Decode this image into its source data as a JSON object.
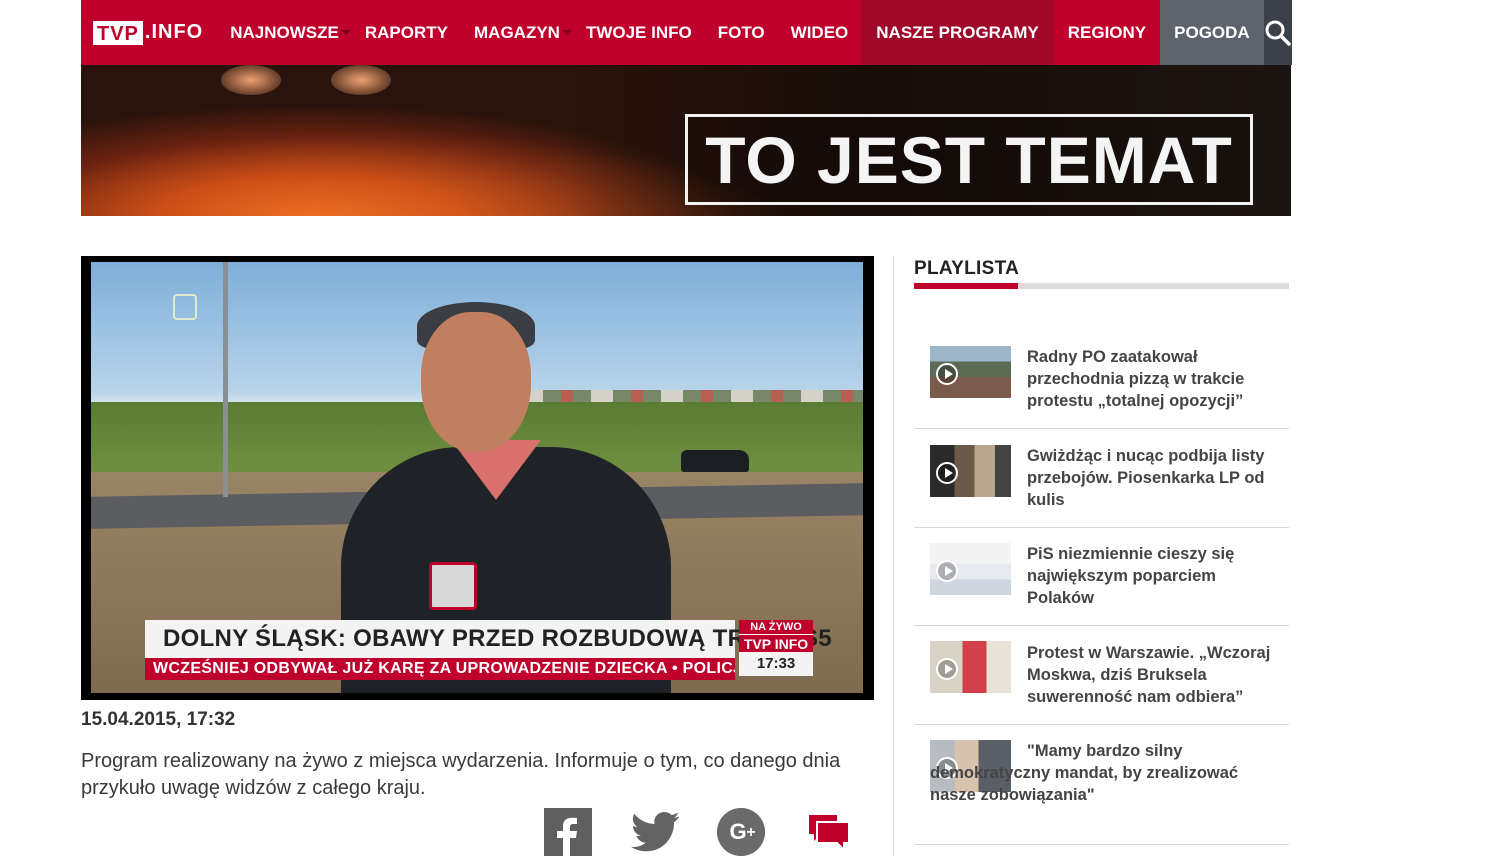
{
  "nav": {
    "logo_box": "TVP",
    "logo_rest": ".INFO",
    "items": [
      {
        "label": "NAJNOWSZE"
      },
      {
        "label": "RAPORTY"
      },
      {
        "label": "MAGAZYN"
      },
      {
        "label": "TWOJE INFO"
      },
      {
        "label": "FOTO"
      },
      {
        "label": "WIDEO"
      },
      {
        "label": "NASZE PROGRAMY"
      },
      {
        "label": "REGIONY"
      },
      {
        "label": "POGODA"
      }
    ],
    "search_icon": "search-icon",
    "colors": {
      "brand": "#c0002c",
      "programy_bg": "#a0082b",
      "pogoda_bg": "#5d636b",
      "search_bg": "#3b4148"
    }
  },
  "banner": {
    "title": "TO JEST TEMAT"
  },
  "video": {
    "lower_third": "DOLNY ŚLĄSK: OBAWY PRZED ROZBUDOWĄ TRASY S5",
    "ticker": "WCZEŚNIEJ ODBYWAŁ JUŻ KARĘ ZA UPROWADZENIE DZIECKA • POLICJA:",
    "live_label": "NA ŻYWO",
    "live_logo": "TVP INFO",
    "live_time": "17:33"
  },
  "article": {
    "date": "15.04.2015, 17:32",
    "description": "Program realizowany na żywo z miejsca wydarzenia. Informuje o tym, co danego dnia przykuło uwagę widzów z całego kraju."
  },
  "share": {
    "icons": [
      "facebook-icon",
      "twitter-icon",
      "google-plus-icon",
      "comments-icon"
    ]
  },
  "playlist": {
    "title": "PLAYLISTA",
    "items": [
      {
        "title": "Radny PO zaatakował przechodnia pizzą w trakcie protestu „totalnej opozycji”"
      },
      {
        "title": "Gwiżdżąc i nucąc podbija listy przebojów. Piosenkarka LP od kulis"
      },
      {
        "title": "PiS niezmiennie cieszy się największym poparciem Polaków"
      },
      {
        "title": "Protest w Warszawie. „Wczoraj Moskwa, dziś Bruksela suwerenność nam odbiera”"
      },
      {
        "title": "\"Mamy bardzo silny demokratyczny mandat, by zrealizować nasze zobowiązania\""
      }
    ]
  }
}
